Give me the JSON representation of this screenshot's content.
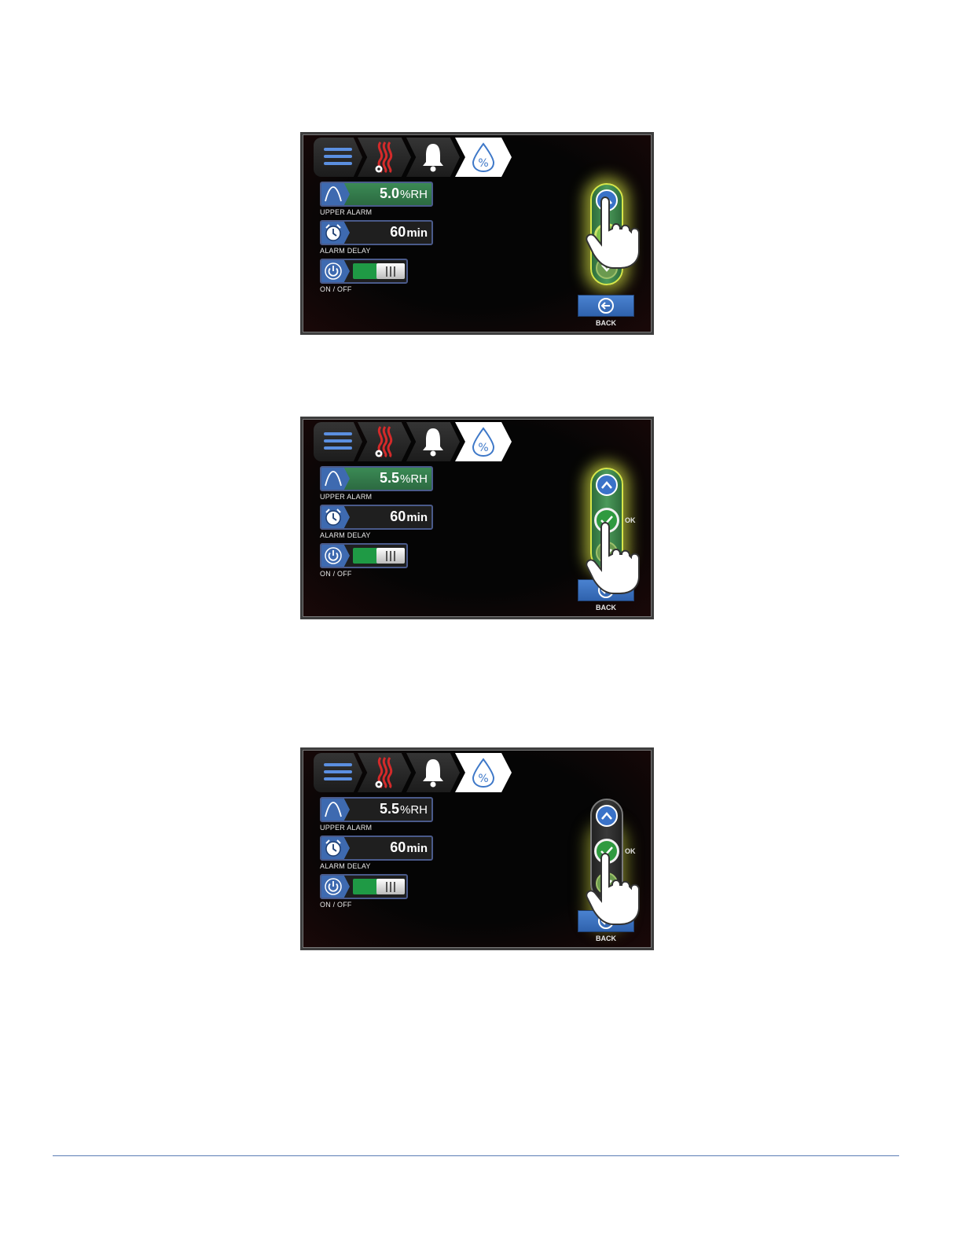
{
  "screens": [
    {
      "upper_alarm": {
        "value": "5.0",
        "unit": "%RH",
        "label": "UPPER ALARM"
      },
      "alarm_delay": {
        "value": "60",
        "unit": "min",
        "label": "ALARM DELAY"
      },
      "power": {
        "label": "ON / OFF",
        "state": "on"
      },
      "back_label": "BACK"
    },
    {
      "upper_alarm": {
        "value": "5.5",
        "unit": "%RH",
        "label": "UPPER ALARM"
      },
      "alarm_delay": {
        "value": "60",
        "unit": "min",
        "label": "ALARM DELAY"
      },
      "power": {
        "label": "ON / OFF",
        "state": "on"
      },
      "ok_label": "OK",
      "back_label": "BACK"
    },
    {
      "upper_alarm": {
        "value": "5.5",
        "unit": "%RH",
        "label": "UPPER ALARM"
      },
      "alarm_delay": {
        "value": "60",
        "unit": "min",
        "label": "ALARM DELAY"
      },
      "power": {
        "label": "ON / OFF",
        "state": "on"
      },
      "ok_label": "OK",
      "back_label": "BACK"
    }
  ],
  "icons": {
    "nav": [
      "menu-icon",
      "heater-settings-icon",
      "alarm-bell-icon",
      "humidity-percent-icon"
    ],
    "fields": [
      "upper-alarm-curve-icon",
      "clock-icon",
      "power-icon"
    ],
    "spinner": [
      "chevron-up-icon",
      "check-icon",
      "chevron-down-icon"
    ],
    "back": "back-arrow-icon",
    "pointer": "hand-pointer-icon"
  },
  "colors": {
    "active_field": "#3b8a55",
    "accent_blue": "#3e6ab0",
    "toggle_on": "#1f9a45",
    "heater_red": "#d42a2a",
    "glow": "#d7e64a"
  }
}
